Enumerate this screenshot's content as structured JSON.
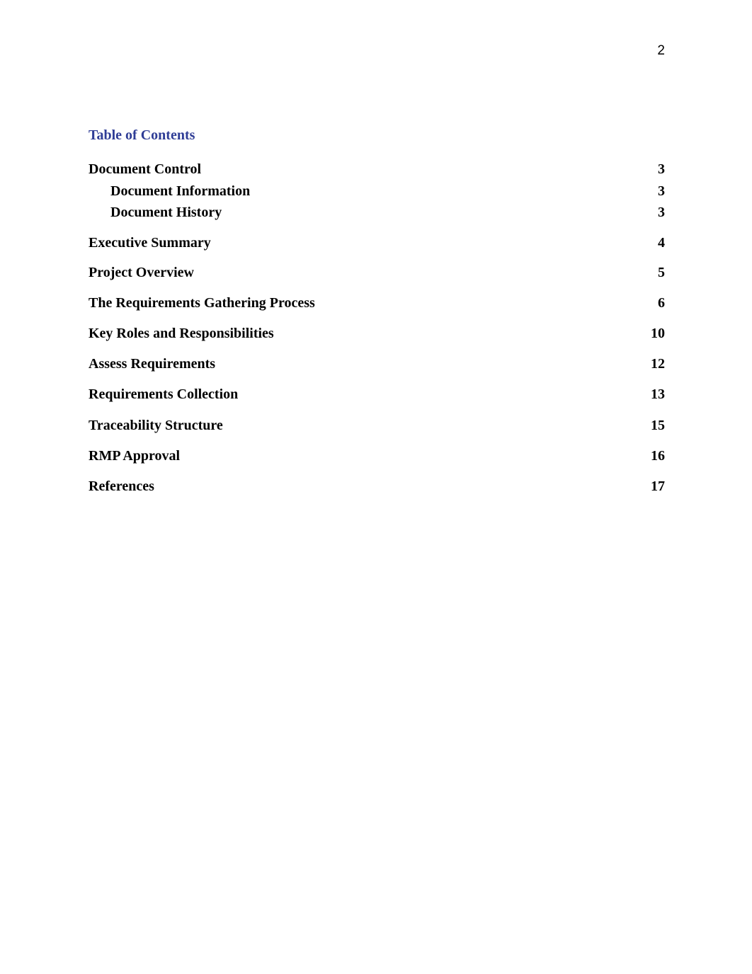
{
  "page_number": "2",
  "toc": {
    "title": "Table of Contents",
    "entries": [
      {
        "label": "Document Control",
        "page": "3"
      },
      {
        "label": "Document Information",
        "page": "3"
      },
      {
        "label": "Document History",
        "page": "3"
      },
      {
        "label": "Executive Summary",
        "page": "4"
      },
      {
        "label": "Project Overview",
        "page": "5"
      },
      {
        "label": "The Requirements Gathering Process",
        "page": "6"
      },
      {
        "label": "Key Roles and Responsibilities",
        "page": "10"
      },
      {
        "label": "Assess Requirements",
        "page": "12"
      },
      {
        "label": "Requirements Collection",
        "page": "13"
      },
      {
        "label": "Traceability Structure",
        "page": "15"
      },
      {
        "label": "RMP Approval",
        "page": "16"
      },
      {
        "label": "References",
        "page": "17"
      }
    ]
  }
}
